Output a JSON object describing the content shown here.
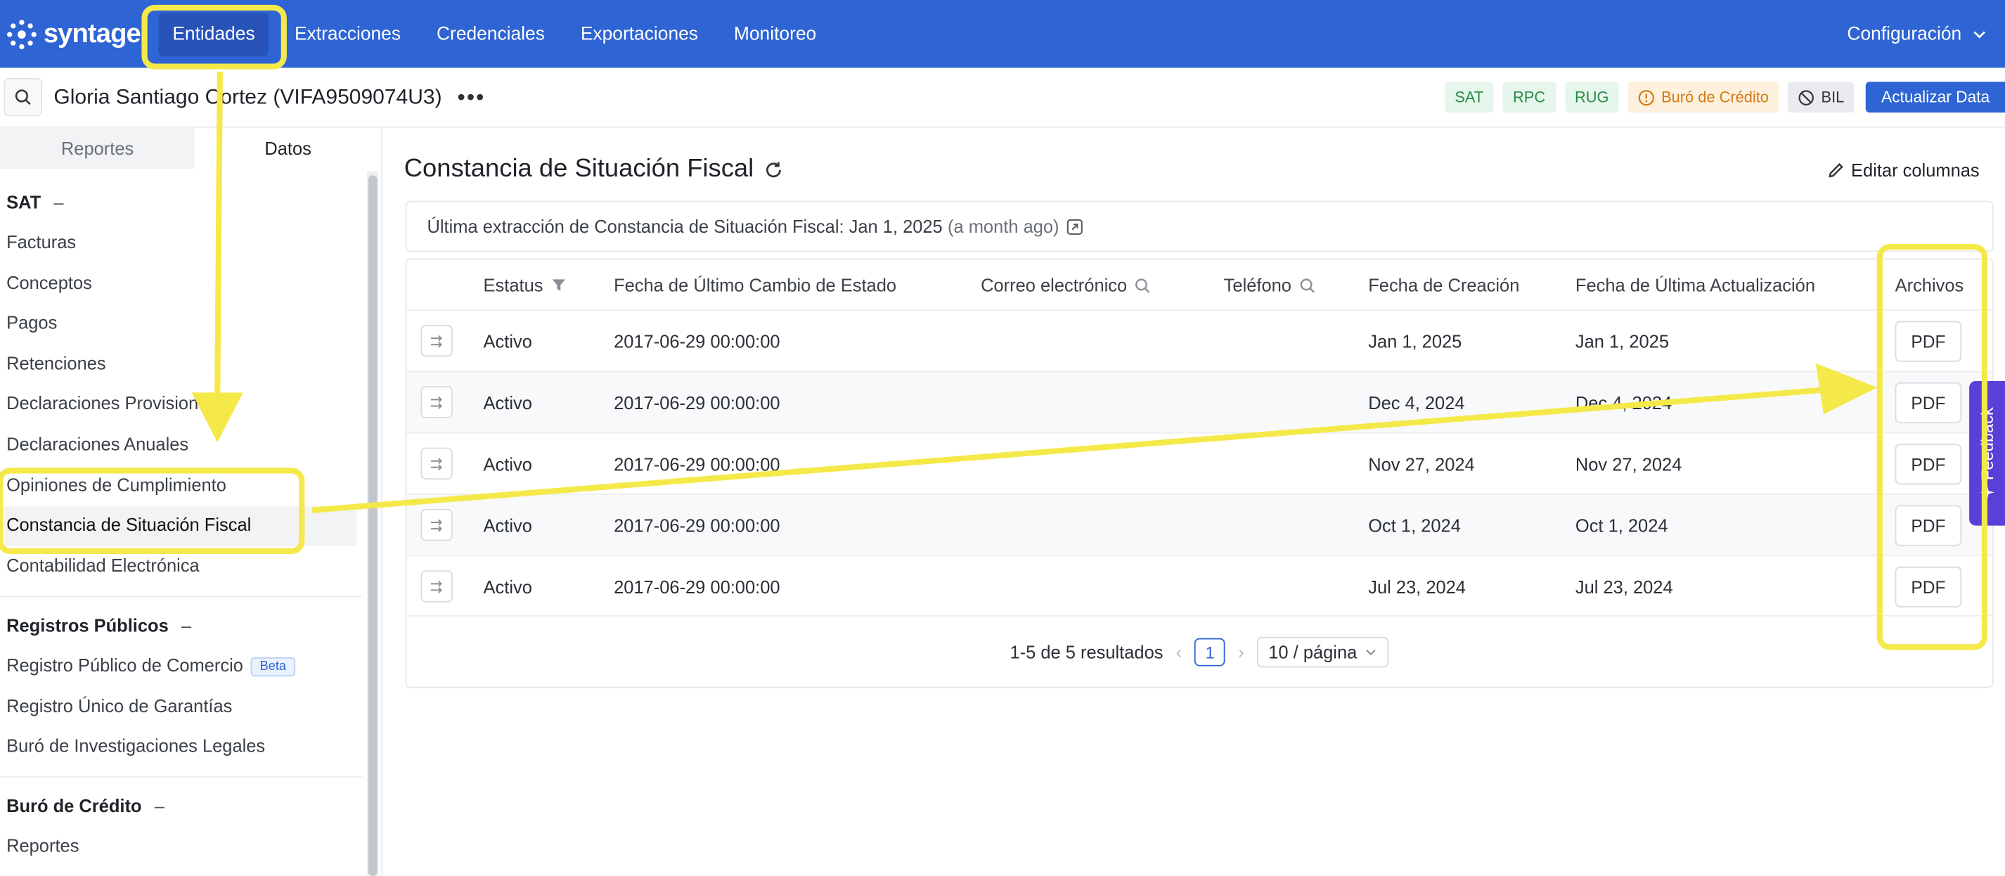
{
  "app": {
    "brand": "syntage"
  },
  "nav": {
    "items": [
      "Entidades",
      "Extracciones",
      "Credenciales",
      "Exportaciones",
      "Monitoreo"
    ],
    "config": "Configuración"
  },
  "entity": {
    "name": "Gloria Santiago Cortez (VIFA9509074U3)",
    "tags": {
      "sat": "SAT",
      "rpc": "RPC",
      "rug": "RUG",
      "buro": "Buró de Crédito",
      "bil": "BIL"
    },
    "update_label": "Actualizar Data"
  },
  "sidebar": {
    "tabs": [
      "Reportes",
      "Datos"
    ],
    "sat": {
      "title": "SAT",
      "items": [
        "Facturas",
        "Conceptos",
        "Pagos",
        "Retenciones",
        "Declaraciones Provisionales",
        "Declaraciones Anuales",
        "Opiniones de Cumplimiento",
        "Constancia de Situación Fiscal",
        "Contabilidad Electrónica"
      ]
    },
    "registros": {
      "title": "Registros Públicos",
      "items": [
        "Registro Público de Comercio",
        "Registro Único de Garantías",
        "Buró de Investigaciones Legales"
      ],
      "beta": "Beta"
    },
    "buro": {
      "title": "Buró de Crédito",
      "items": [
        "Reportes"
      ]
    }
  },
  "main": {
    "title": "Constancia de Situación Fiscal",
    "edit_columns": "Editar columnas",
    "extraction": {
      "text": "Última extracción de Constancia de Situación Fiscal: Jan 1, 2025",
      "ago": "(a month ago)"
    },
    "columns": [
      "Estatus",
      "Fecha de Último Cambio de Estado",
      "Correo electrónico",
      "Teléfono",
      "Fecha de Creación",
      "Fecha de Última Actualización",
      "Archivos"
    ],
    "rows": [
      {
        "status": "Activo",
        "changed": "2017-06-29 00:00:00",
        "email": "",
        "phone": "",
        "created": "Jan 1, 2025",
        "updated": "Jan 1, 2025",
        "file": "PDF"
      },
      {
        "status": "Activo",
        "changed": "2017-06-29 00:00:00",
        "email": "",
        "phone": "",
        "created": "Dec 4, 2024",
        "updated": "Dec 4, 2024",
        "file": "PDF"
      },
      {
        "status": "Activo",
        "changed": "2017-06-29 00:00:00",
        "email": "",
        "phone": "",
        "created": "Nov 27, 2024",
        "updated": "Nov 27, 2024",
        "file": "PDF"
      },
      {
        "status": "Activo",
        "changed": "2017-06-29 00:00:00",
        "email": "",
        "phone": "",
        "created": "Oct 1, 2024",
        "updated": "Oct 1, 2024",
        "file": "PDF"
      },
      {
        "status": "Activo",
        "changed": "2017-06-29 00:00:00",
        "email": "",
        "phone": "",
        "created": "Jul 23, 2024",
        "updated": "Jul 23, 2024",
        "file": "PDF"
      }
    ],
    "pagination": {
      "summary": "1-5 de 5 resultados",
      "page": "1",
      "page_size": "10 / página"
    }
  },
  "feedback": "Feedback",
  "colors": {
    "primary": "#2e64d3",
    "highlight": "#f5e94a",
    "feedback": "#5b3fd9"
  }
}
